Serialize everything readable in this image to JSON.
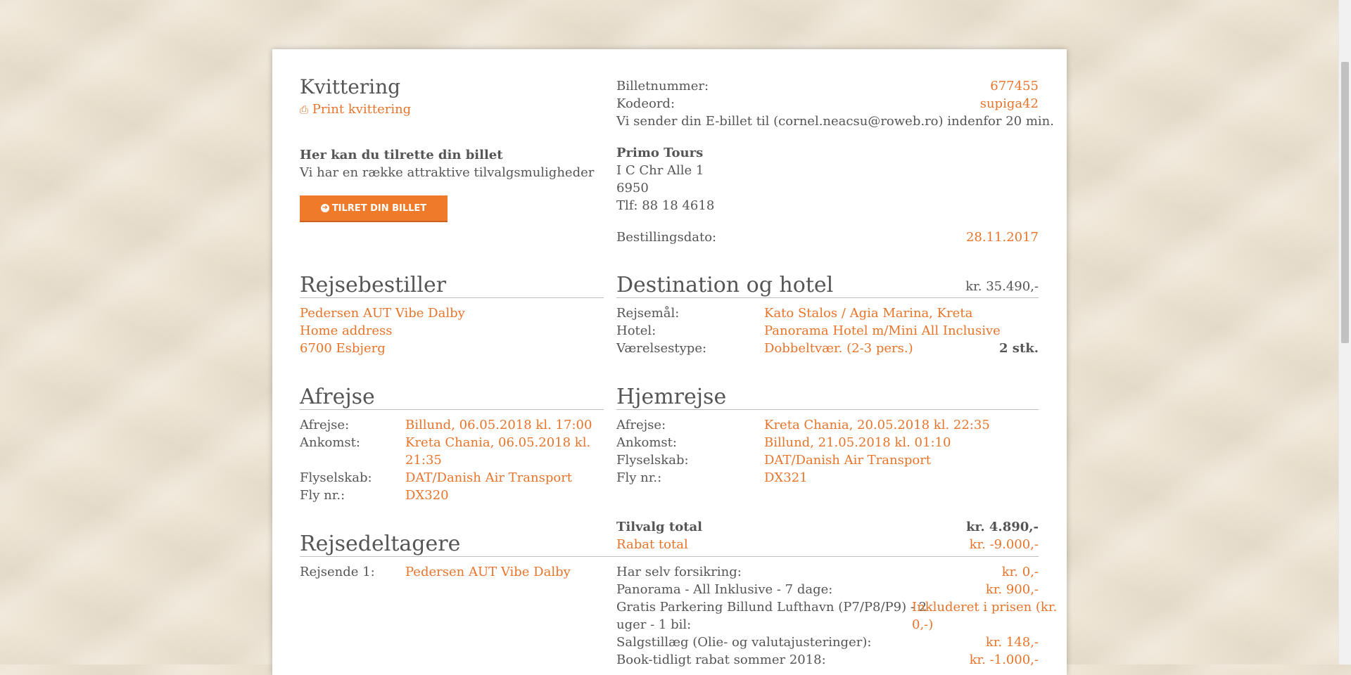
{
  "receipt": {
    "title": "Kvittering",
    "print_label": "Print kvittering",
    "customize_heading": "Her kan du tilrette din billet",
    "customize_text": "Vi har en række attraktive tilvalgsmuligheder",
    "customize_button": "TILRET DIN BILLET"
  },
  "ticket": {
    "number_label": "Billetnummer:",
    "number_value": "677455",
    "code_label": "Kodeord:",
    "code_value": "supiga42",
    "email_text": "Vi sender din E-billet til (cornel.neacsu@roweb.ro) indenfor 20 min."
  },
  "company": {
    "name": "Primo Tours",
    "address": "I C Chr Alle 1",
    "zip": "6950",
    "phone": "Tlf: 88 18 4618",
    "order_date_label": "Bestillingsdato:",
    "order_date_value": "28.11.2017"
  },
  "booker": {
    "heading": "Rejsebestiller",
    "name": "Pedersen AUT Vibe Dalby",
    "address": "Home address",
    "city": "6700 Esbjerg"
  },
  "destination": {
    "heading": "Destination og hotel",
    "price": "kr. 35.490,-",
    "dest_label": "Rejsemål:",
    "dest_value": "Kato Stalos / Agia Marina, Kreta",
    "hotel_label": "Hotel:",
    "hotel_value": "Panorama Hotel m/Mini All Inclusive",
    "room_label": "Værelsestype:",
    "room_value": "Dobbeltvær. (2-3 pers.)",
    "room_qty": "2 stk."
  },
  "outbound": {
    "heading": "Afrejse",
    "dep_label": "Afrejse:",
    "dep_value": "Billund, 06.05.2018 kl. 17:00",
    "arr_label": "Ankomst:",
    "arr_value_1": "Kreta Chania, 06.05.2018 kl.",
    "arr_value_2": "21:35",
    "airline_label": "Flyselskab:",
    "airline_value": "DAT/Danish Air Transport",
    "flight_label": "Fly nr.:",
    "flight_value": "DX320"
  },
  "return": {
    "heading": "Hjemrejse",
    "dep_label": "Afrejse:",
    "dep_value": "Kreta Chania, 20.05.2018 kl. 22:35",
    "arr_label": "Ankomst:",
    "arr_value": "Billund, 21.05.2018 kl. 01:10",
    "airline_label": "Flyselskab:",
    "airline_value": "DAT/Danish Air Transport",
    "flight_label": "Fly nr.:",
    "flight_value": "DX321"
  },
  "participants": {
    "heading": "Rejsedeltagere",
    "traveler_label": "Rejsende 1:",
    "traveler_value": "Pedersen AUT Vibe Dalby"
  },
  "extras": {
    "total_label": "Tilvalg total",
    "total_value": "kr. 4.890,-",
    "discount_label": "Rabat total",
    "discount_value": "kr. -9.000,-",
    "items": [
      {
        "label": "Har selv forsikring:",
        "value": "kr. 0,-"
      },
      {
        "label": "Panorama - All Inklusive - 7 dage:",
        "value": "kr. 900,-"
      },
      {
        "label_1": "Gratis Parkering Billund Lufthavn (P7/P8/P9) - 2",
        "label_2": "uger - 1 bil:",
        "value_1": "Inkluderet i prisen (kr.",
        "value_2": "0,-)"
      },
      {
        "label": "Salgstillæg (Olie- og valutajusteringer):",
        "value": "kr. 148,-"
      },
      {
        "label": "Book-tidligt rabat sommer 2018:",
        "value": "kr. -1.000,-"
      }
    ]
  }
}
